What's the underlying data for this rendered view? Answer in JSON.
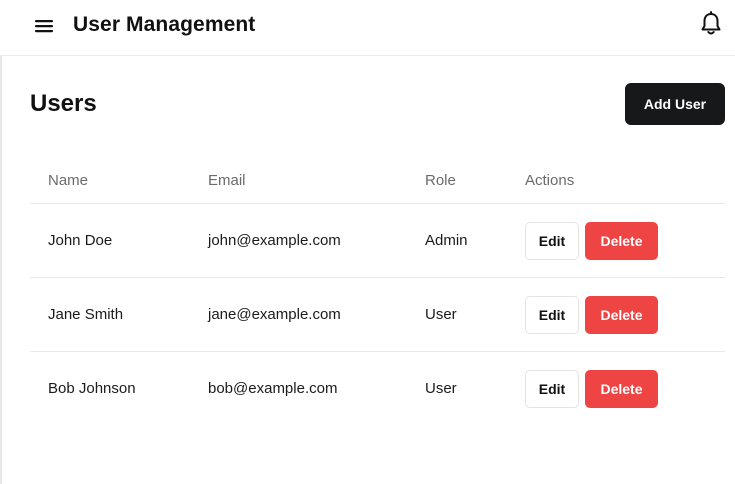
{
  "header": {
    "menu_icon": "hamburger-menu-icon",
    "title": "User Management",
    "notification_icon": "bell-icon"
  },
  "main": {
    "title": "Users",
    "add_user_label": "Add User",
    "columns": [
      "Name",
      "Email",
      "Role",
      "Actions"
    ],
    "rows": [
      {
        "name": "John Doe",
        "email": "john@example.com",
        "role": "Admin",
        "edit_label": "Edit",
        "delete_label": "Delete"
      },
      {
        "name": "Jane Smith",
        "email": "jane@example.com",
        "role": "User",
        "edit_label": "Edit",
        "delete_label": "Delete"
      },
      {
        "name": "Bob Johnson",
        "email": "bob@example.com",
        "role": "User",
        "edit_label": "Edit",
        "delete_label": "Delete"
      }
    ]
  },
  "colors": {
    "primary_button": "#16181a",
    "danger_button": "#ef4444",
    "muted_text": "#6b6b6b",
    "divider": "#e9e9e9"
  }
}
